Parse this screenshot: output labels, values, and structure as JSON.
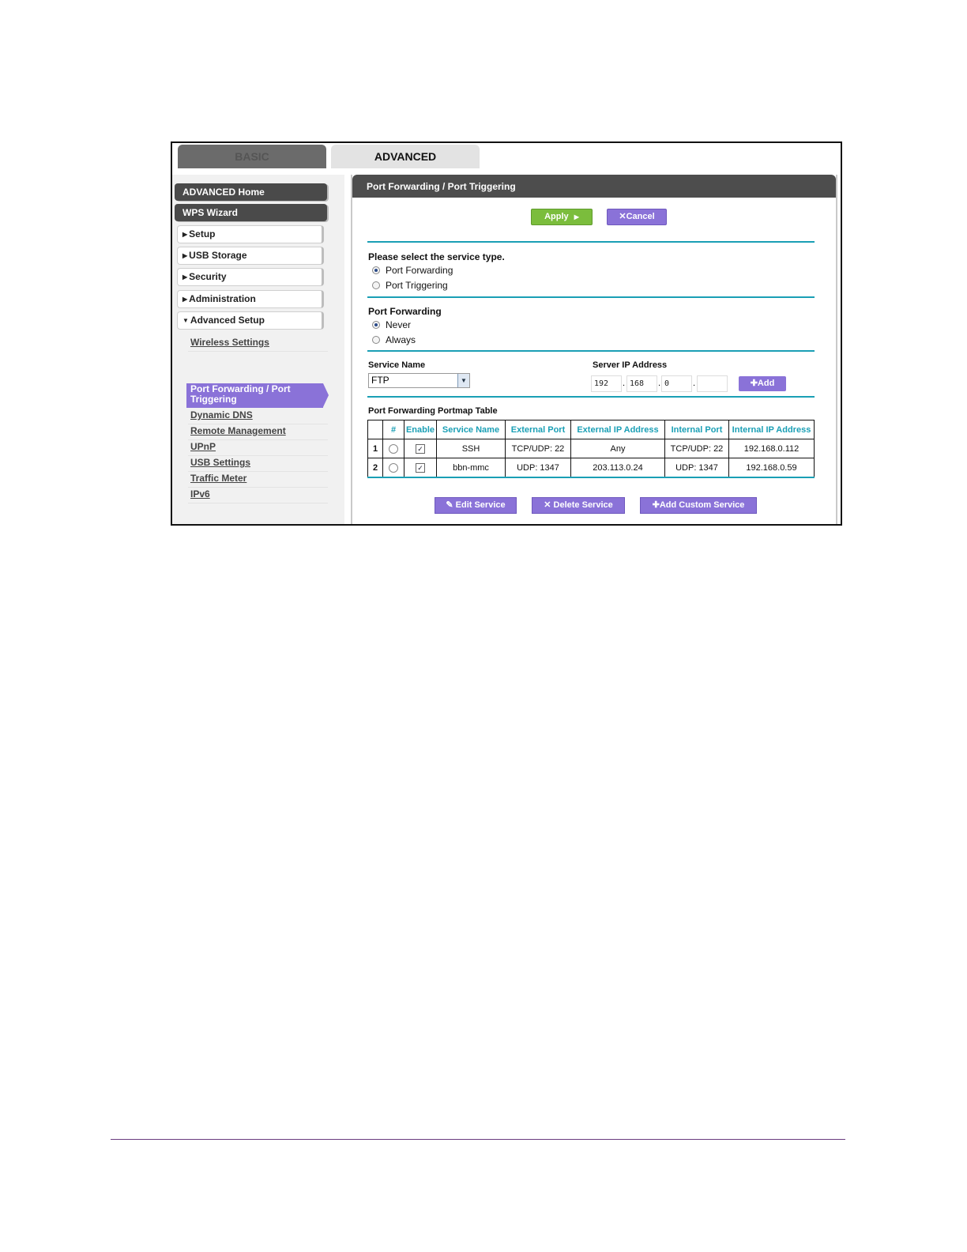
{
  "tabs": {
    "basic": "BASIC",
    "advanced": "ADVANCED"
  },
  "sidebar": {
    "advanced_home": "ADVANCED Home",
    "wps_wizard": "WPS Wizard",
    "sections": [
      "Setup",
      "USB Storage",
      "Security",
      "Administration",
      "Advanced Setup"
    ],
    "sub_items": [
      "Wireless Settings",
      "Port Forwarding / Port Triggering",
      "Dynamic DNS",
      "Remote Management",
      "UPnP",
      "USB Settings",
      "Traffic Meter",
      "IPv6"
    ]
  },
  "panel": {
    "title": "Port Forwarding / Port Triggering",
    "apply_label": "Apply",
    "cancel_label": "Cancel",
    "service_type_heading": "Please select the service type.",
    "service_type_options": [
      "Port Forwarding",
      "Port Triggering"
    ],
    "port_forwarding_heading": "Port Forwarding",
    "port_forwarding_options": [
      "Never",
      "Always"
    ],
    "service_name_label": "Service Name",
    "service_name_value": "FTP",
    "server_ip_label": "Server IP Address",
    "server_ip": [
      "192",
      "168",
      "0",
      ""
    ],
    "add_label": "Add",
    "table_title": "Port Forwarding Portmap Table",
    "table_headers": [
      "",
      "#",
      "Enable",
      "Service Name",
      "External Port",
      "External IP Address",
      "Internal Port",
      "Internal IP Address"
    ],
    "rows": [
      {
        "num": "1",
        "service": "SSH",
        "ext_port": "TCP/UDP: 22",
        "ext_ip": "Any",
        "int_port": "TCP/UDP: 22",
        "int_ip": "192.168.0.112"
      },
      {
        "num": "2",
        "service": "bbn-mmc",
        "ext_port": "UDP: 1347",
        "ext_ip": "203.113.0.24",
        "int_port": "UDP: 1347",
        "int_ip": "192.168.0.59"
      }
    ],
    "edit_label": "Edit Service",
    "delete_label": "Delete Service",
    "add_custom_label": "Add Custom Service"
  },
  "colors": {
    "accent_purple": "#8a72d8",
    "accent_green": "#7bbd3c",
    "rule_teal": "#1a9fb5"
  }
}
